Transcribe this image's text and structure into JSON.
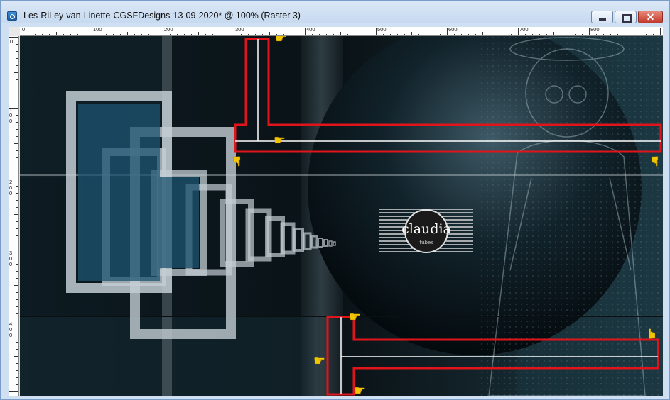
{
  "window": {
    "title": "Les-RiLey-van-Linette-CGSFDesigns-13-09-2020* @ 100% (Raster 3)",
    "icons": {
      "app": "app-image-icon",
      "minimize": "minimize-icon",
      "maximize": "maximize-icon",
      "close": "close-icon"
    },
    "close_glyph": "✕"
  },
  "ruler": {
    "horizontal_labels": [
      "0",
      "100",
      "200",
      "300",
      "400",
      "500",
      "600",
      "700",
      "800"
    ],
    "vertical_labels": [
      "0",
      "100",
      "200",
      "300",
      "400"
    ]
  },
  "canvas": {
    "watermark_text": "claudia",
    "watermark_subtext": "tubes",
    "pointer_icon": "pointing-hand-icon",
    "pointer_glyph": "☛",
    "colors": {
      "selection_outline": "#e0151b",
      "guide_line": "#ffffff",
      "pointer": "#f3c400",
      "frame": "#c3cdd3"
    }
  }
}
